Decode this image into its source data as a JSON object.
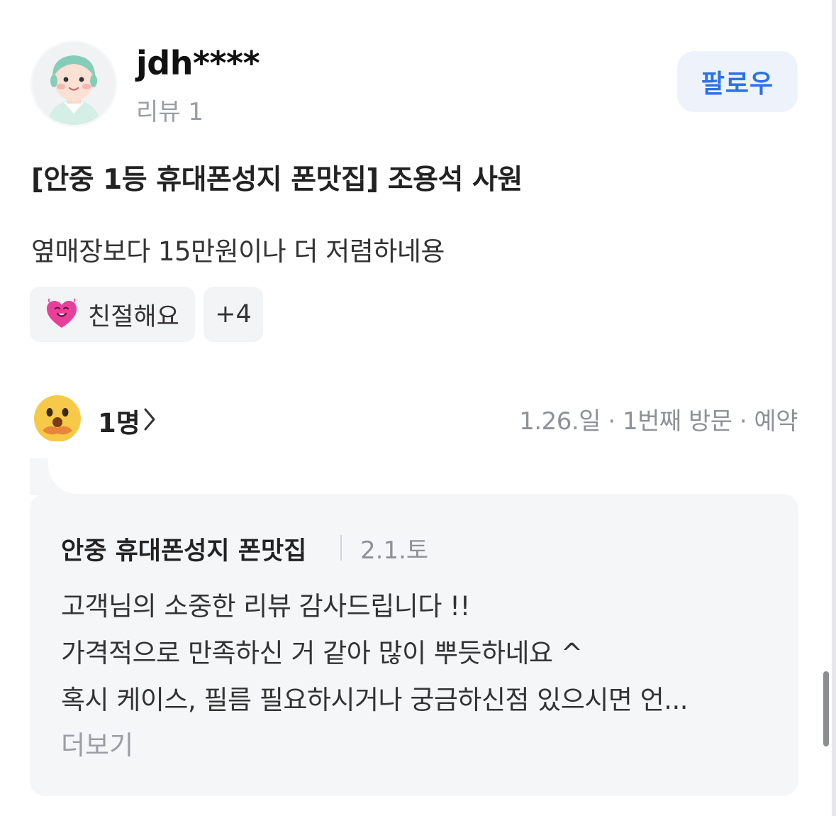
{
  "reviewer": {
    "username": "jdh****",
    "review_count": "리뷰 1",
    "follow_label": "팔로우"
  },
  "review": {
    "title": "[안중 1등 휴대폰성지 폰맛집] 조용석 사원",
    "body": "옆매장보다 15만원이나 더 저렴하네용",
    "tags": [
      {
        "label": "친절해요",
        "icon": "heart-smile-icon"
      },
      {
        "label": "+4"
      }
    ],
    "reactions_count": "1명",
    "visit_info": "1.26.일 · 1번째 방문 · 예약"
  },
  "owner_reply": {
    "store_name": "안중 휴대폰성지 폰맛집",
    "date": "2.1.토",
    "lines": [
      "고객님의 소중한 리뷰 감사드립니다 !!",
      "가격적으로 만족하신 거 같아 많이 뿌듯하네요 ^",
      "혹시 케이스, 필름 필요하시거나 궁금하신점 있으시면 언..."
    ],
    "more_label": "더보기"
  },
  "colors": {
    "accent_blue": "#2b72e6",
    "follow_bg": "#eef3fb",
    "chip_bg": "#f3f4f6",
    "reply_bg": "#f5f6f8",
    "muted_text": "#8e9196"
  }
}
